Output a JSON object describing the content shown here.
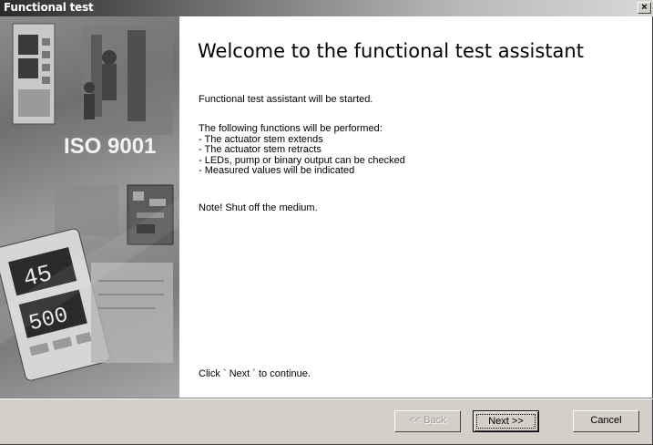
{
  "window": {
    "title": "Functional test",
    "close_label": "×"
  },
  "sidebar": {
    "image_text": "ISO 9001",
    "display_top_1": "45",
    "display_top_2": "500"
  },
  "main": {
    "heading": "Welcome to the functional test assistant",
    "intro": "Functional test assistant will be started.",
    "functions_header": "The following functions will be performed:",
    "functions": [
      "- The actuator stem extends",
      "- The actuator stem retracts",
      "- LEDs, pump or binary output can be checked",
      "- Measured values will be indicated"
    ],
    "note": "Note! Shut off the medium.",
    "continue_hint": "Click ` Next ´ to continue."
  },
  "buttons": {
    "back_label": "<< Back",
    "next_label": "Next >>",
    "cancel_label": "Cancel"
  }
}
